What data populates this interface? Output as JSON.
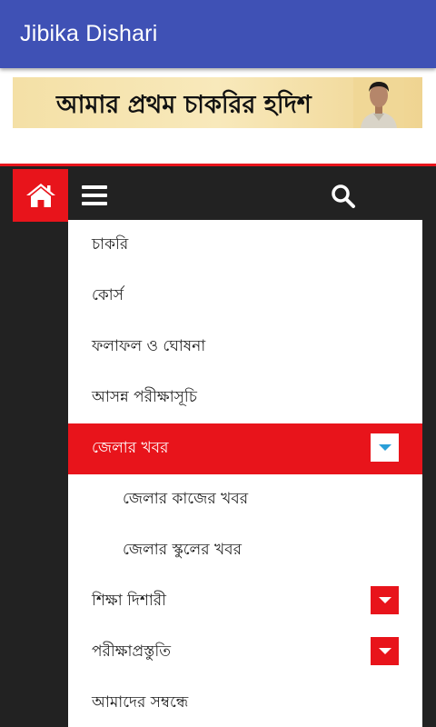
{
  "app": {
    "title": "Jibika Dishari"
  },
  "banner": {
    "text": "আমার প্রথম চাকরির হদিশ"
  },
  "navbar": {
    "home_icon": "home-icon",
    "menu_icon": "hamburger-menu-icon",
    "search_icon": "search-icon",
    "accent_color": "#e8141b",
    "background_color": "#222222"
  },
  "menu": {
    "items": [
      {
        "label": "চাকরি",
        "active": false,
        "level": 0,
        "has_toggle": false
      },
      {
        "label": "কোর্স",
        "active": false,
        "level": 0,
        "has_toggle": false
      },
      {
        "label": "ফলাফল ও ঘোষনা",
        "active": false,
        "level": 0,
        "has_toggle": false
      },
      {
        "label": "আসন্ন পরীক্ষাসূচি",
        "active": false,
        "level": 0,
        "has_toggle": false
      },
      {
        "label": "জেলার খবর",
        "active": true,
        "level": 0,
        "has_toggle": true
      },
      {
        "label": "জেলার কাজের খবর",
        "active": false,
        "level": 1,
        "has_toggle": false
      },
      {
        "label": "জেলার স্কুলের খবর",
        "active": false,
        "level": 1,
        "has_toggle": false
      },
      {
        "label": "শিক্ষা দিশারী",
        "active": false,
        "level": 0,
        "has_toggle": true
      },
      {
        "label": "পরীক্ষাপ্রস্তুতি",
        "active": false,
        "level": 0,
        "has_toggle": true
      },
      {
        "label": "আমাদের সম্বন্ধে",
        "active": false,
        "level": 0,
        "has_toggle": false
      }
    ]
  }
}
